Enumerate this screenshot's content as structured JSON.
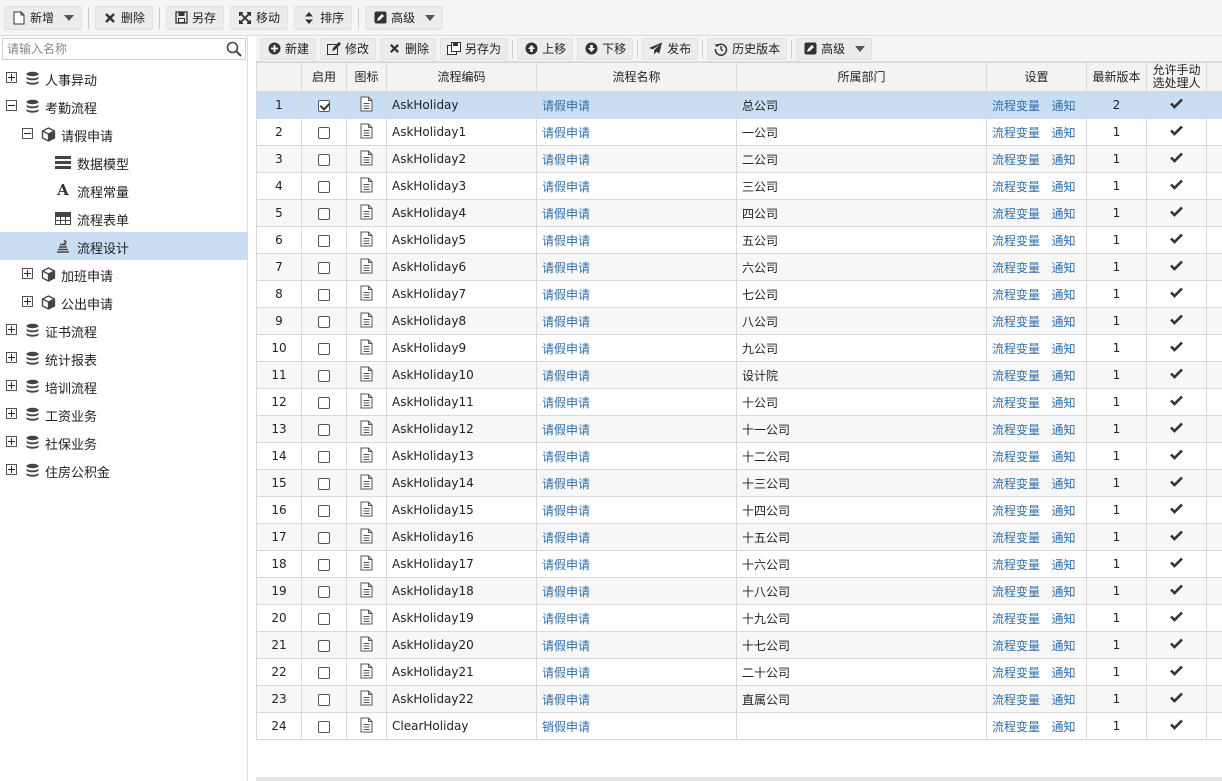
{
  "top_toolbar": {
    "new": "新增",
    "delete": "删除",
    "save_as": "另存",
    "move": "移动",
    "sort": "排序",
    "advanced": "高级"
  },
  "sidebar": {
    "search_placeholder": "请输入名称",
    "tree": [
      {
        "label": "人事异动",
        "toggle": "plus",
        "icon": "database-icon",
        "level": 0
      },
      {
        "label": "考勤流程",
        "toggle": "minus",
        "icon": "database-icon",
        "level": 0
      },
      {
        "label": "请假申请",
        "toggle": "minus",
        "icon": "cube-icon",
        "level": 1
      },
      {
        "label": "数据模型",
        "toggle": "none",
        "icon": "list-icon",
        "level": 2
      },
      {
        "label": "流程常量",
        "toggle": "none",
        "icon": "font-icon",
        "level": 2
      },
      {
        "label": "流程表单",
        "toggle": "none",
        "icon": "table-icon",
        "level": 2
      },
      {
        "label": "流程设计",
        "toggle": "none",
        "icon": "stack-icon",
        "level": 2,
        "selected": true
      },
      {
        "label": "加班申请",
        "toggle": "plus",
        "icon": "cube-icon",
        "level": 1
      },
      {
        "label": "公出申请",
        "toggle": "plus",
        "icon": "cube-icon",
        "level": 1
      },
      {
        "label": "证书流程",
        "toggle": "plus",
        "icon": "database-icon",
        "level": 0
      },
      {
        "label": "统计报表",
        "toggle": "plus",
        "icon": "database-icon",
        "level": 0
      },
      {
        "label": "培训流程",
        "toggle": "plus",
        "icon": "database-icon",
        "level": 0
      },
      {
        "label": "工资业务",
        "toggle": "plus",
        "icon": "database-icon",
        "level": 0
      },
      {
        "label": "社保业务",
        "toggle": "plus",
        "icon": "database-icon",
        "level": 0
      },
      {
        "label": "住房公积金",
        "toggle": "plus",
        "icon": "database-icon",
        "level": 0
      }
    ]
  },
  "grid_toolbar": {
    "new": "新建",
    "edit": "修改",
    "delete": "删除",
    "save_as": "另存为",
    "move_up": "上移",
    "move_down": "下移",
    "publish": "发布",
    "history": "历史版本",
    "advanced": "高级"
  },
  "table": {
    "headers": {
      "enabled": "启用",
      "icon": "图标",
      "code": "流程编码",
      "name": "流程名称",
      "dept": "所属部门",
      "settings": "设置",
      "version": "最新版本",
      "manual_line1": "允许手动",
      "manual_line2": "选处理人"
    },
    "settings_link1": "流程变量",
    "settings_link2": "通知",
    "rows": [
      {
        "no": "1",
        "enabled": true,
        "code": "AskHoliday",
        "name": "请假申请",
        "dept": "总公司",
        "version": "2"
      },
      {
        "no": "2",
        "enabled": false,
        "code": "AskHoliday1",
        "name": "请假申请",
        "dept": "一公司",
        "version": "1"
      },
      {
        "no": "3",
        "enabled": false,
        "code": "AskHoliday2",
        "name": "请假申请",
        "dept": "二公司",
        "version": "1"
      },
      {
        "no": "4",
        "enabled": false,
        "code": "AskHoliday3",
        "name": "请假申请",
        "dept": "三公司",
        "version": "1"
      },
      {
        "no": "5",
        "enabled": false,
        "code": "AskHoliday4",
        "name": "请假申请",
        "dept": "四公司",
        "version": "1"
      },
      {
        "no": "6",
        "enabled": false,
        "code": "AskHoliday5",
        "name": "请假申请",
        "dept": "五公司",
        "version": "1"
      },
      {
        "no": "7",
        "enabled": false,
        "code": "AskHoliday6",
        "name": "请假申请",
        "dept": "六公司",
        "version": "1"
      },
      {
        "no": "8",
        "enabled": false,
        "code": "AskHoliday7",
        "name": "请假申请",
        "dept": "七公司",
        "version": "1"
      },
      {
        "no": "9",
        "enabled": false,
        "code": "AskHoliday8",
        "name": "请假申请",
        "dept": "八公司",
        "version": "1"
      },
      {
        "no": "10",
        "enabled": false,
        "code": "AskHoliday9",
        "name": "请假申请",
        "dept": "九公司",
        "version": "1"
      },
      {
        "no": "11",
        "enabled": false,
        "code": "AskHoliday10",
        "name": "请假申请",
        "dept": "设计院",
        "version": "1"
      },
      {
        "no": "12",
        "enabled": false,
        "code": "AskHoliday11",
        "name": "请假申请",
        "dept": "十公司",
        "version": "1"
      },
      {
        "no": "13",
        "enabled": false,
        "code": "AskHoliday12",
        "name": "请假申请",
        "dept": "十一公司",
        "version": "1"
      },
      {
        "no": "14",
        "enabled": false,
        "code": "AskHoliday13",
        "name": "请假申请",
        "dept": "十二公司",
        "version": "1"
      },
      {
        "no": "15",
        "enabled": false,
        "code": "AskHoliday14",
        "name": "请假申请",
        "dept": "十三公司",
        "version": "1"
      },
      {
        "no": "16",
        "enabled": false,
        "code": "AskHoliday15",
        "name": "请假申请",
        "dept": "十四公司",
        "version": "1"
      },
      {
        "no": "17",
        "enabled": false,
        "code": "AskHoliday16",
        "name": "请假申请",
        "dept": "十五公司",
        "version": "1"
      },
      {
        "no": "18",
        "enabled": false,
        "code": "AskHoliday17",
        "name": "请假申请",
        "dept": "十六公司",
        "version": "1"
      },
      {
        "no": "19",
        "enabled": false,
        "code": "AskHoliday18",
        "name": "请假申请",
        "dept": "十八公司",
        "version": "1"
      },
      {
        "no": "20",
        "enabled": false,
        "code": "AskHoliday19",
        "name": "请假申请",
        "dept": "十九公司",
        "version": "1"
      },
      {
        "no": "21",
        "enabled": false,
        "code": "AskHoliday20",
        "name": "请假申请",
        "dept": "十七公司",
        "version": "1"
      },
      {
        "no": "22",
        "enabled": false,
        "code": "AskHoliday21",
        "name": "请假申请",
        "dept": "二十公司",
        "version": "1"
      },
      {
        "no": "23",
        "enabled": false,
        "code": "AskHoliday22",
        "name": "请假申请",
        "dept": "直属公司",
        "version": "1"
      },
      {
        "no": "24",
        "enabled": false,
        "code": "ClearHoliday",
        "name": "销假申请",
        "dept": "",
        "version": "1"
      }
    ]
  }
}
